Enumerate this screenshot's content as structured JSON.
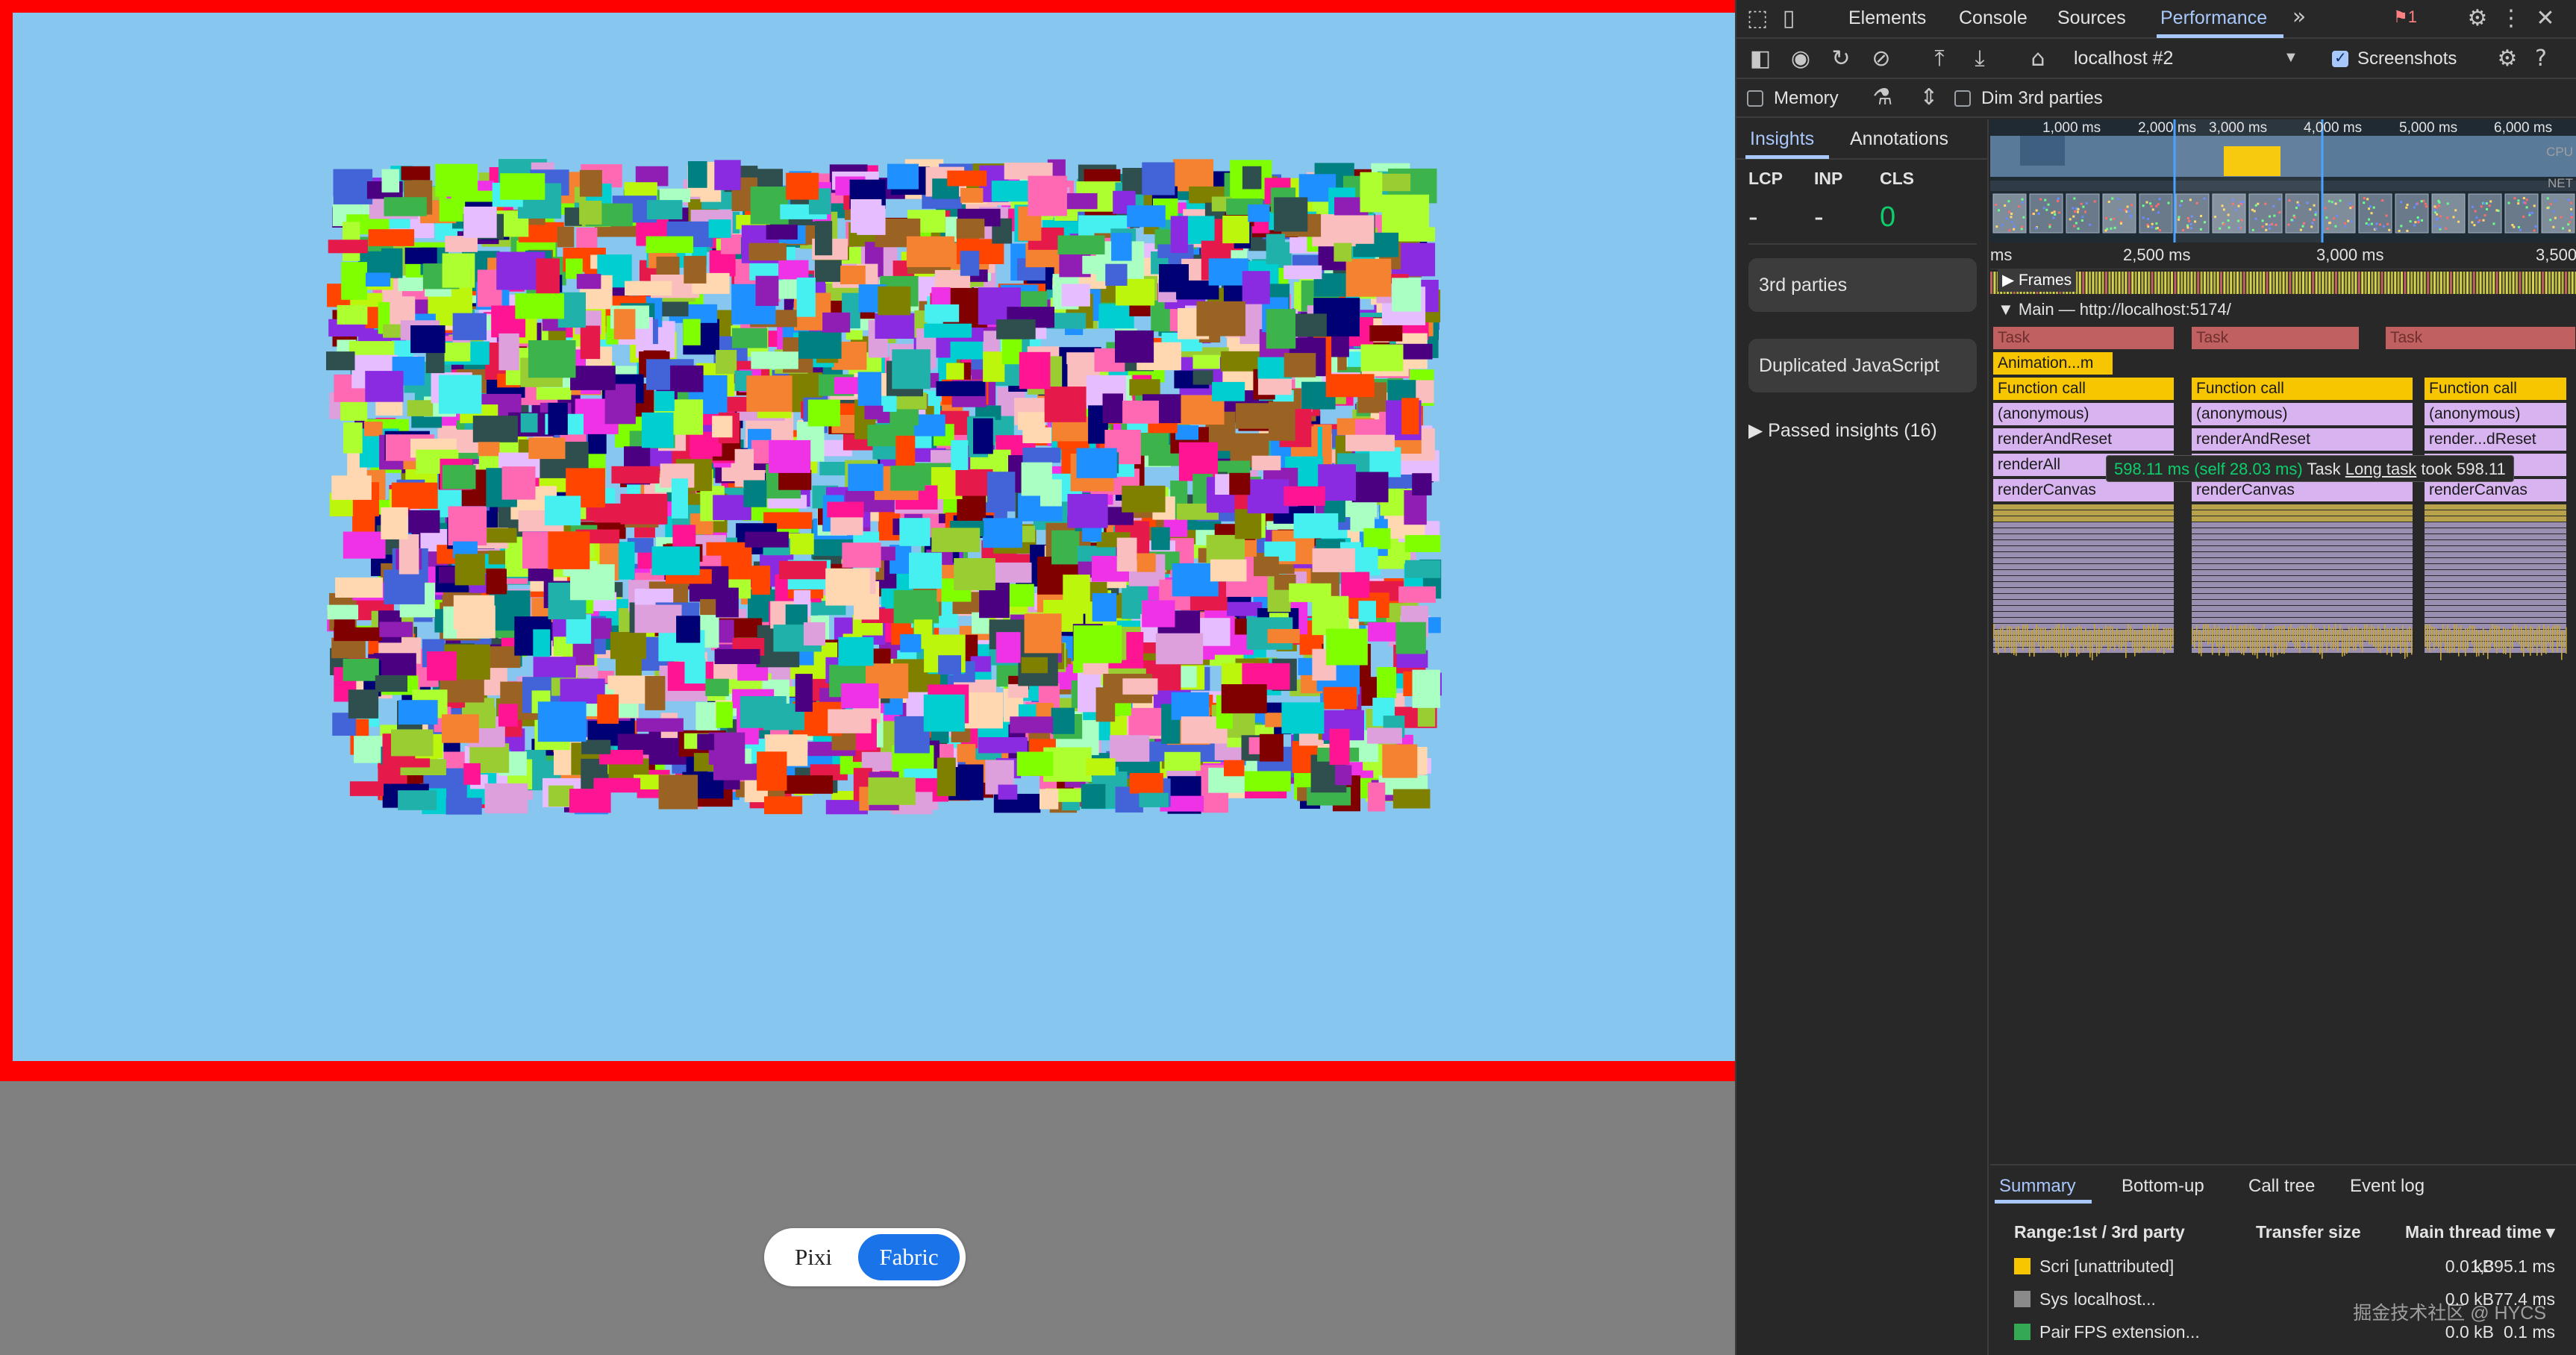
{
  "app": {
    "toggle": {
      "pixi_label": "Pixi",
      "fabric_label": "Fabric",
      "selected": "Fabric"
    }
  },
  "devtools": {
    "tabs": [
      "Elements",
      "Console",
      "Sources",
      "Performance"
    ],
    "active_tab": "Performance",
    "error_count": "1",
    "toolbar": {
      "target": "localhost #2",
      "screenshots_label": "Screenshots",
      "screenshots_checked": true
    },
    "toolbar2": {
      "memory_label": "Memory",
      "dim_label": "Dim 3rd parties"
    },
    "sidebar": {
      "tabs": [
        "Insights",
        "Annotations"
      ],
      "metrics": [
        {
          "name": "LCP",
          "value": "-"
        },
        {
          "name": "INP",
          "value": "-"
        },
        {
          "name": "CLS",
          "value": "0"
        }
      ],
      "cards": [
        "3rd parties",
        "Duplicated JavaScript"
      ],
      "passed": "Passed insights (16)"
    },
    "overview": {
      "ticks": [
        "1,000 ms",
        "2,000 ms",
        "3,000 ms",
        "4,000 ms",
        "5,000 ms",
        "6,000 ms"
      ],
      "cpu_label": "CPU",
      "net_label": "NET"
    },
    "ruler": [
      "ms",
      "2,500 ms",
      "3,000 ms",
      "3,500"
    ],
    "frames_label": "Frames",
    "main_label": "Main — http://localhost:5174/",
    "flame": {
      "task_label": "Task",
      "animation_label": "Animation...m",
      "columns": [
        {
          "function_call": "Function call",
          "stack": [
            "(anonymous)",
            "renderAndReset",
            "renderAll",
            "renderCanvas"
          ]
        },
        {
          "function_call": "Function call",
          "stack": [
            "(anonymous)",
            "renderAndReset",
            "renderAll",
            "renderCanvas"
          ]
        },
        {
          "function_call": "Function call",
          "stack": [
            "(anonymous)",
            "render...dReset",
            "renderAll",
            "renderCanvas"
          ]
        }
      ]
    },
    "tooltip": {
      "duration": "598.11 ms (self 28.03 ms)",
      "kind": "Task",
      "long_task": "Long task",
      "tail": "took 598.11"
    },
    "summary": {
      "tabs": [
        "Summary",
        "Bottom-up",
        "Call tree",
        "Event log"
      ],
      "headers": {
        "range": "Range:1st / 3rd party",
        "transfer": "Transfer size",
        "main_thread": "Main thread time ▾"
      },
      "rows": [
        {
          "cat": "Scri",
          "name": "[unattributed]",
          "size": "0.0 kB",
          "time": "1,395.1 ms",
          "color": "#f7c600"
        },
        {
          "cat": "Sys",
          "name": "localhost...",
          "size": "0.0 kB",
          "time": "77.4 ms",
          "color": "#8a8a8a"
        },
        {
          "cat": "Pair",
          "name": "FPS extension...",
          "size": "0.0 kB",
          "time": "0.1 ms",
          "color": "#34a853"
        }
      ]
    },
    "watermark": "掘金技术社区 @ HYCS"
  }
}
